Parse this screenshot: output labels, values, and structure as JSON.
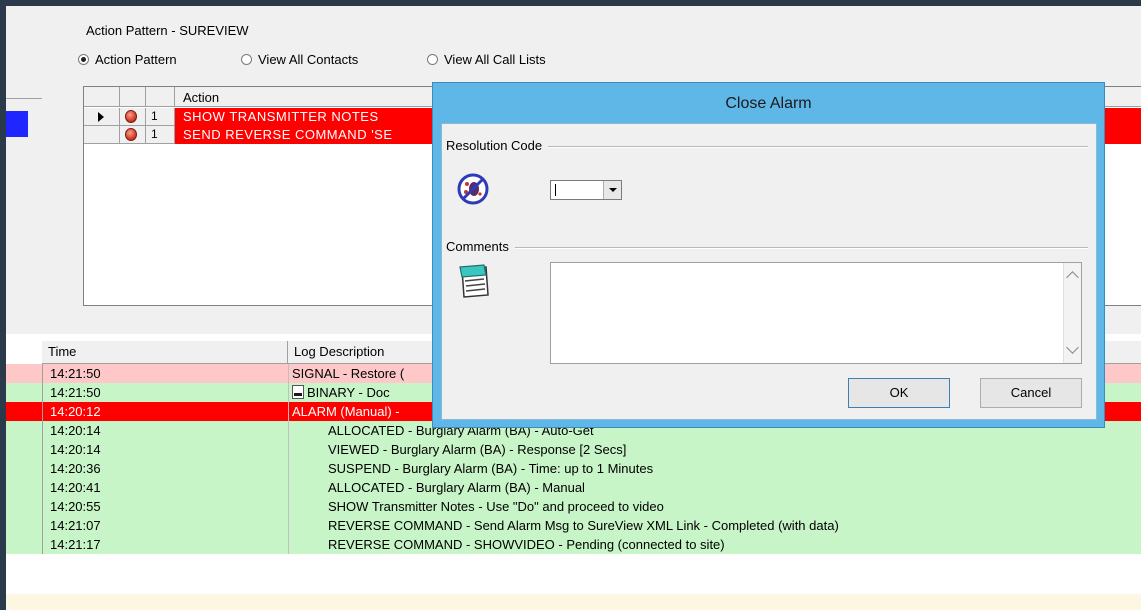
{
  "panel": {
    "title": "Action Pattern - SUREVIEW",
    "radio_options": [
      {
        "label": "Action Pattern",
        "selected": true
      },
      {
        "label": "View All Contacts",
        "selected": false
      },
      {
        "label": "View All Call Lists",
        "selected": false
      }
    ]
  },
  "action_grid": {
    "header": "Action",
    "rows": [
      {
        "num": "1",
        "text": "SHOW TRANSMITTER NOTES",
        "current": true
      },
      {
        "num": "1",
        "text": "SEND REVERSE COMMAND 'SE",
        "current": false
      }
    ]
  },
  "log": {
    "headers": {
      "time": "Time",
      "description": "Log Description"
    },
    "rows": [
      {
        "time": "14:21:50",
        "desc": "SIGNAL - Restore (",
        "bg": "#ffc8c8",
        "color": "#000",
        "indent": false,
        "doc": false
      },
      {
        "time": "14:21:50",
        "desc": "BINARY - Doc",
        "bg": "#c8f5c8",
        "color": "#000",
        "indent": false,
        "doc": true
      },
      {
        "time": "14:20:12",
        "desc": "ALARM (Manual) -",
        "bg": "#ff0000",
        "color": "#fff",
        "indent": false,
        "doc": false
      },
      {
        "time": "14:20:14",
        "desc": "ALLOCATED - Burglary Alarm (BA) - Auto-Get",
        "bg": "#c8f5c8",
        "color": "#000",
        "indent": true,
        "doc": false
      },
      {
        "time": "14:20:14",
        "desc": "VIEWED - Burglary Alarm (BA) - Response [2 Secs]",
        "bg": "#c8f5c8",
        "color": "#000",
        "indent": true,
        "doc": false
      },
      {
        "time": "14:20:36",
        "desc": "SUSPEND - Burglary Alarm (BA) - Time: up to 1 Minutes",
        "bg": "#c8f5c8",
        "color": "#000",
        "indent": true,
        "doc": false
      },
      {
        "time": "14:20:41",
        "desc": "ALLOCATED - Burglary Alarm (BA) - Manual",
        "bg": "#c8f5c8",
        "color": "#000",
        "indent": true,
        "doc": false
      },
      {
        "time": "14:20:55",
        "desc": "SHOW Transmitter Notes - Use \"Do\" and proceed to video",
        "bg": "#c8f5c8",
        "color": "#000",
        "indent": true,
        "doc": false
      },
      {
        "time": "14:21:07",
        "desc": "REVERSE COMMAND - Send Alarm Msg to SureView XML Link - Completed (with data)",
        "bg": "#c8f5c8",
        "color": "#000",
        "indent": true,
        "doc": false
      },
      {
        "time": "14:21:17",
        "desc": "REVERSE COMMAND - SHOWVIDEO - Pending (connected to site)",
        "bg": "#c8f5c8",
        "color": "#000",
        "indent": true,
        "doc": false
      }
    ]
  },
  "dialog": {
    "title": "Close Alarm",
    "resolution_label": "Resolution Code",
    "resolution_value": "",
    "comments_label": "Comments",
    "comments_value": "",
    "ok_label": "OK",
    "cancel_label": "Cancel"
  },
  "colors": {
    "alarm_red": "#ff0000",
    "log_green": "#c8f5c8",
    "log_pink": "#ffc8c8",
    "titlebar_blue": "#5fb7e8",
    "indicator_blue": "#1f26ff"
  },
  "icons": {
    "resolution": "no-bug-icon",
    "comments": "notepad-icon"
  }
}
